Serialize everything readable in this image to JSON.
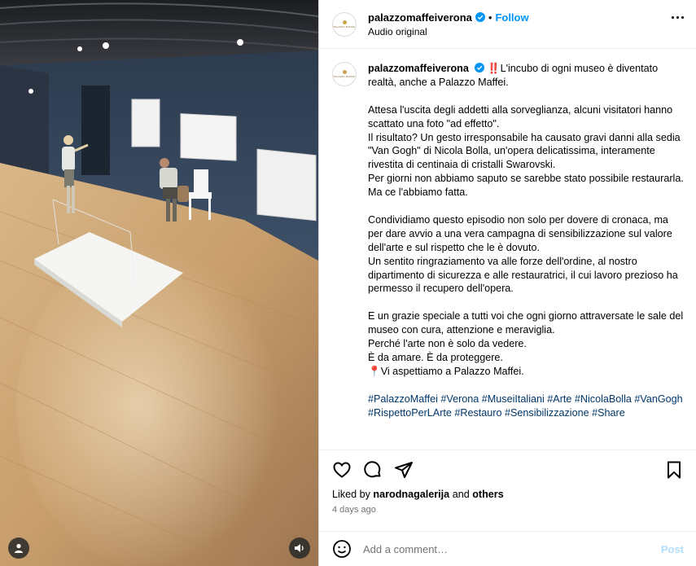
{
  "post": {
    "username": "palazzomaffeiverona",
    "follow_label": "Follow",
    "dot": "•",
    "audio_label": "Audio original",
    "avatar_logo_text": "PALAZZO MAFFEI"
  },
  "caption": {
    "username": "palazzomaffeiverona",
    "lead_emoji": "‼️",
    "paragraphs": [
      "L'incubo di ogni museo è diventato realtà, anche a Palazzo Maffei.",
      "Attesa l'uscita degli addetti alla sorveglianza, alcuni visitatori hanno scattato una foto \"ad effetto\".\nIl risultato? Un gesto irresponsabile ha causato gravi danni alla sedia \"Van Gogh\" di Nicola Bolla, un'opera delicatissima, interamente rivestita di centinaia di cristalli Swarovski.\nPer giorni non abbiamo saputo se sarebbe stato possibile restaurarla.\nMa ce l'abbiamo fatta.",
      "Condividiamo questo episodio non solo per dovere di cronaca, ma per dare avvio a una vera campagna di sensibilizzazione sul valore dell'arte e sul rispetto che le è dovuto.\nUn sentito ringraziamento va alle forze dell'ordine, al nostro dipartimento di sicurezza e alle restauratrici, il cui lavoro prezioso ha permesso il recupero dell'opera.",
      "E un grazie speciale a tutti voi che ogni giorno attraversate le sale del museo con cura, attenzione e meraviglia.\nPerché l'arte non è solo da vedere.\nÈ da amare. È da proteggere.",
      "Vi aspettiamo a Palazzo Maffei."
    ],
    "pin_emoji": "📍",
    "hashtags": "#PalazzoMaffei #Verona #MuseiItaliani #Arte #NicolaBolla #VanGogh #RispettoPerLArte #Restauro #Sensibilizzazione #Share"
  },
  "actions": {
    "liked_by_prefix": "Liked by ",
    "liked_by_user": "narodnagalerija",
    "liked_by_suffix": " and ",
    "liked_by_others": "others",
    "time_ago": "4 days ago"
  },
  "comment": {
    "placeholder": "Add a comment…",
    "post_label": "Post"
  },
  "colors": {
    "accent": "#0095f6",
    "hashtag": "#00376b",
    "muted": "#737373",
    "post_disabled": "#b2dffc"
  },
  "icons": [
    "verified-badge-icon",
    "more-options-icon",
    "heart-icon",
    "comment-icon",
    "share-icon",
    "bookmark-icon",
    "emoji-icon",
    "user-tag-icon",
    "audio-icon"
  ]
}
